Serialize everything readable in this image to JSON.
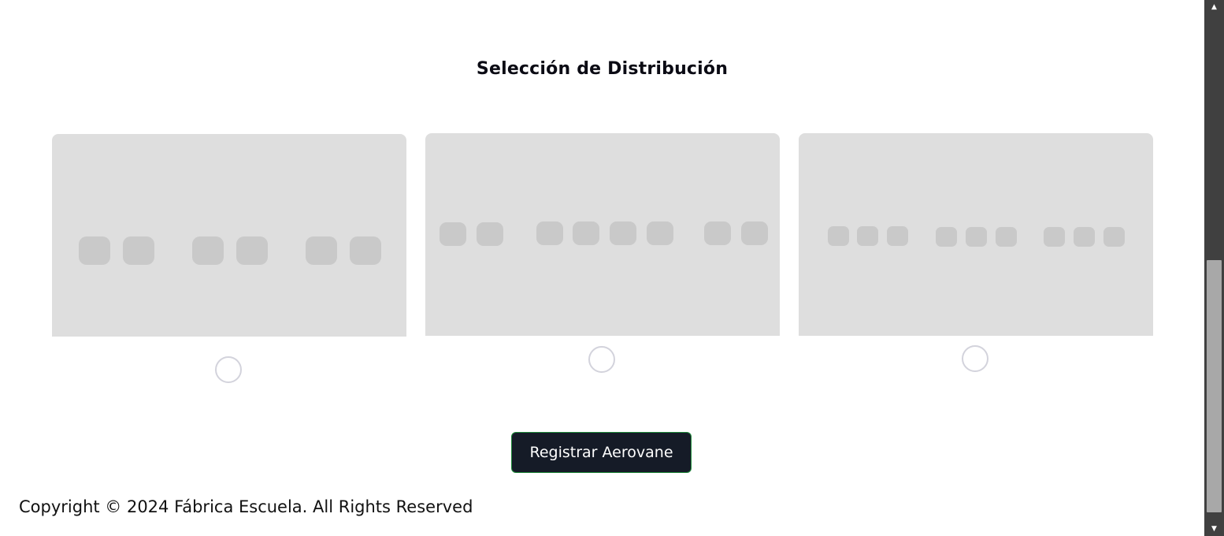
{
  "page": {
    "section_title": "Selección de Distribución",
    "register_button_label": "Registrar Aerovane",
    "footer_text": "Copyright © 2024 Fábrica Escuela. All Rights Reserved"
  },
  "distribution_options": [
    {
      "layout": "2-2-2",
      "selected": false
    },
    {
      "layout": "2-4-2",
      "selected": false
    },
    {
      "layout": "3-3-3",
      "selected": false
    }
  ],
  "scrollbar": {
    "up_icon": "triangle-up-icon",
    "down_icon": "triangle-down-icon"
  }
}
